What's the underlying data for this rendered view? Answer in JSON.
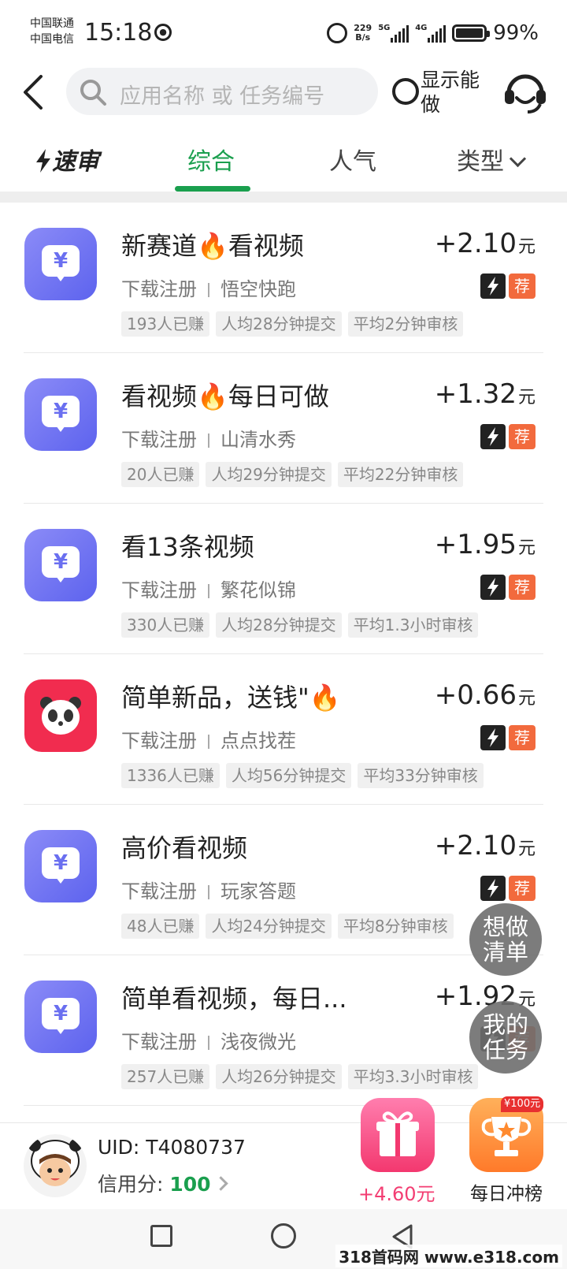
{
  "status_bar": {
    "carrier_1": "中国联通",
    "carrier_2": "中国电信",
    "time": "15:18",
    "net_speed_value": "229",
    "net_speed_unit": "B/s",
    "signal_1": "5G",
    "signal_2": "4G",
    "battery": "99%",
    "battery_level": 0.99
  },
  "header": {
    "search_placeholder": "应用名称 或 任务编号",
    "show_doable": "显示能做"
  },
  "tabs": [
    {
      "label": "速审"
    },
    {
      "label": "综合",
      "active": true
    },
    {
      "label": "人气"
    },
    {
      "label": "类型"
    }
  ],
  "tasks": [
    {
      "title": "新赛道🔥看视频",
      "reward": "+2.10",
      "unit": "元",
      "category": "下载注册",
      "app": "悟空快跑",
      "tags": [
        "193人已赚",
        "人均28分钟提交",
        "平均2分钟审核"
      ]
    },
    {
      "title": "看视频🔥每日可做",
      "reward": "+1.32",
      "unit": "元",
      "category": "下载注册",
      "app": "山清水秀",
      "tags": [
        "20人已赚",
        "人均29分钟提交",
        "平均22分钟审核"
      ]
    },
    {
      "title": "看13条视频",
      "reward": "+1.95",
      "unit": "元",
      "category": "下载注册",
      "app": "繁花似锦",
      "tags": [
        "330人已赚",
        "人均28分钟提交",
        "平均1.3小时审核"
      ]
    },
    {
      "title": "简单新品，送钱\"🔥",
      "reward": "+0.66",
      "unit": "元",
      "category": "下载注册",
      "app": "点点找茬",
      "tags": [
        "1336人已赚",
        "人均56分钟提交",
        "平均33分钟审核"
      ]
    },
    {
      "title": "高价看视频",
      "reward": "+2.10",
      "unit": "元",
      "category": "下载注册",
      "app": "玩家答题",
      "tags": [
        "48人已赚",
        "人均24分钟提交",
        "平均8分钟审核"
      ]
    },
    {
      "title": "简单看视频，每日...",
      "reward": "+1.92",
      "unit": "元",
      "category": "下载注册",
      "app": "浅夜微光",
      "tags": [
        "257人已赚",
        "人均26分钟提交",
        "平均3.3小时审核"
      ]
    }
  ],
  "badges": {
    "fast": "lightning-icon",
    "recommend": "荐"
  },
  "icons": {
    "yuan_symbol": "¥"
  },
  "float_buttons": {
    "wishlist_line1": "想做",
    "wishlist_line2": "清单",
    "my_tasks_line1": "我的",
    "my_tasks_line2": "任务"
  },
  "bottom": {
    "uid": "UID: T4080737",
    "credit_label": "信用分: ",
    "credit_value": "100",
    "gift_amount": "+4.60元",
    "trophy_badge": "¥100元",
    "trophy_label": "每日冲榜"
  },
  "watermark": "318首码网 www.e318.com",
  "colors": {
    "accent_green": "#1a9f4e",
    "recommend_orange": "#f26a3d",
    "app_icon_purple": "#6a6ff0",
    "gift_pink": "#f33d72"
  }
}
